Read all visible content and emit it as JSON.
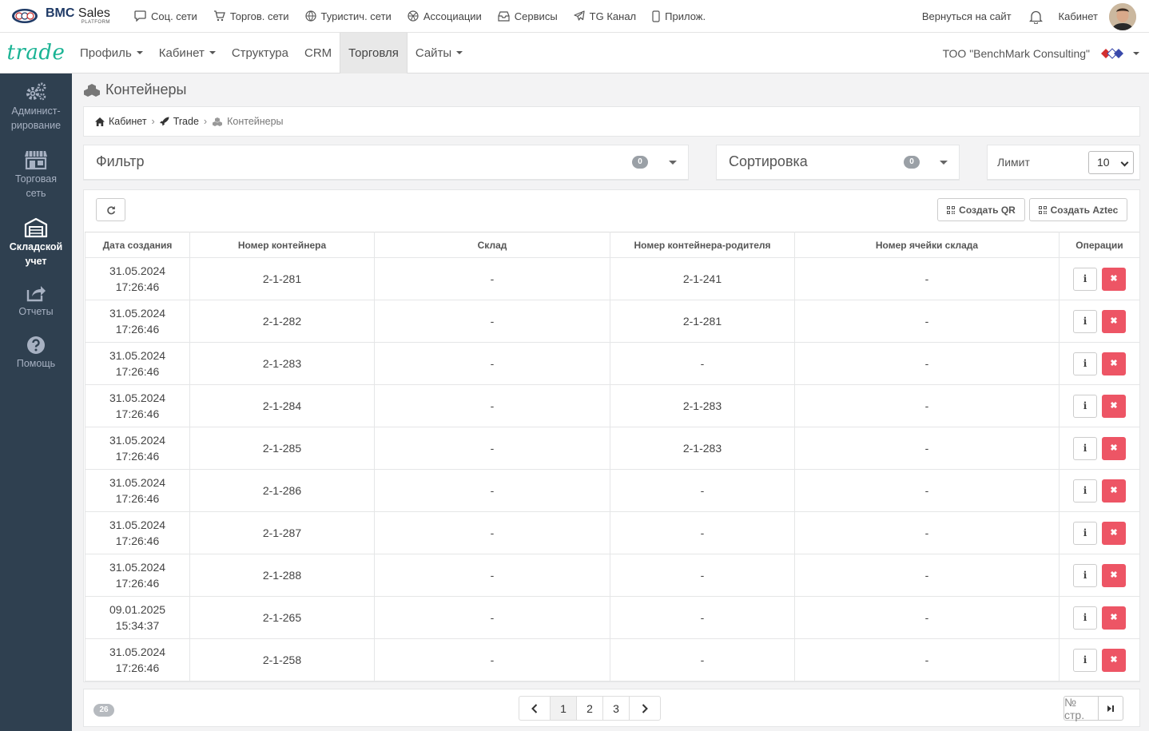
{
  "topbar": {
    "brand_title": "BMC",
    "brand_title_2": "Sales",
    "brand_sub": "PLATFORM",
    "links": [
      {
        "label": "Соц. сети",
        "icon": "chat-icon"
      },
      {
        "label": "Торгов. сети",
        "icon": "cart-icon"
      },
      {
        "label": "Туристич. сети",
        "icon": "globe-icon"
      },
      {
        "label": "Ассоциации",
        "icon": "basketball-icon"
      },
      {
        "label": "Сервисы",
        "icon": "inbox-icon"
      },
      {
        "label": "TG Канал",
        "icon": "telegram-icon"
      },
      {
        "label": "Прилож.",
        "icon": "mobile-icon"
      }
    ],
    "back_label": "Вернуться на сайт",
    "cabinet_label": "Кабинет"
  },
  "navbar": {
    "logo": "trade",
    "items": [
      {
        "label": "Профиль",
        "caret": true
      },
      {
        "label": "Кабинет",
        "caret": true
      },
      {
        "label": "Структура",
        "caret": false
      },
      {
        "label": "CRM",
        "caret": false
      },
      {
        "label": "Торговля",
        "caret": false,
        "active": true
      },
      {
        "label": "Сайты",
        "caret": true
      }
    ],
    "company": "ТОО \"BenchMark Consulting\""
  },
  "sidebar": {
    "items": [
      {
        "line1": "Админист-",
        "line2": "рирование",
        "icon": "cogs-icon"
      },
      {
        "line1": "Торговая",
        "line2": "сеть",
        "icon": "store-icon"
      },
      {
        "line1": "Складской",
        "line2": "учет",
        "icon": "warehouse-icon",
        "active": true
      },
      {
        "line1": "Отчеты",
        "line2": "",
        "icon": "share-icon"
      },
      {
        "line1": "Помощь",
        "line2": "",
        "icon": "question-icon"
      }
    ]
  },
  "page": {
    "title": "Контейнеры",
    "breadcrumb": [
      "Кабинет",
      "Trade",
      "Контейнеры"
    ]
  },
  "filter": {
    "label": "Фильтр",
    "count": "0"
  },
  "sort": {
    "label": "Сортировка",
    "count": "0"
  },
  "limit": {
    "label": "Лимит",
    "value": "10"
  },
  "actions": {
    "create_qr": "Создать QR",
    "create_aztec": "Создать Aztec"
  },
  "table": {
    "columns": [
      "Дата создания",
      "Номер контейнера",
      "Склад",
      "Номер контейнера-родителя",
      "Номер ячейки склада",
      "Операции"
    ],
    "rows": [
      {
        "date": "31.05.2024",
        "time": "17:26:46",
        "number": "2-1-281",
        "warehouse": "-",
        "parent": "2-1-241",
        "cell": "-"
      },
      {
        "date": "31.05.2024",
        "time": "17:26:46",
        "number": "2-1-282",
        "warehouse": "-",
        "parent": "2-1-281",
        "cell": "-"
      },
      {
        "date": "31.05.2024",
        "time": "17:26:46",
        "number": "2-1-283",
        "warehouse": "-",
        "parent": "-",
        "cell": "-"
      },
      {
        "date": "31.05.2024",
        "time": "17:26:46",
        "number": "2-1-284",
        "warehouse": "-",
        "parent": "2-1-283",
        "cell": "-"
      },
      {
        "date": "31.05.2024",
        "time": "17:26:46",
        "number": "2-1-285",
        "warehouse": "-",
        "parent": "2-1-283",
        "cell": "-"
      },
      {
        "date": "31.05.2024",
        "time": "17:26:46",
        "number": "2-1-286",
        "warehouse": "-",
        "parent": "-",
        "cell": "-"
      },
      {
        "date": "31.05.2024",
        "time": "17:26:46",
        "number": "2-1-287",
        "warehouse": "-",
        "parent": "-",
        "cell": "-"
      },
      {
        "date": "31.05.2024",
        "time": "17:26:46",
        "number": "2-1-288",
        "warehouse": "-",
        "parent": "-",
        "cell": "-"
      },
      {
        "date": "09.01.2025",
        "time": "15:34:37",
        "number": "2-1-265",
        "warehouse": "-",
        "parent": "-",
        "cell": "-"
      },
      {
        "date": "31.05.2024",
        "time": "17:26:46",
        "number": "2-1-258",
        "warehouse": "-",
        "parent": "-",
        "cell": "-"
      }
    ],
    "info_glyph": "i",
    "delete_glyph": "✖"
  },
  "pagination": {
    "total": "26",
    "pages": [
      "1",
      "2",
      "3"
    ],
    "current": "1",
    "page_input_placeholder": "№ стр."
  },
  "colors": {
    "accent": "#1ab394",
    "sidebar": "#2f4050",
    "danger": "#ed5565"
  }
}
